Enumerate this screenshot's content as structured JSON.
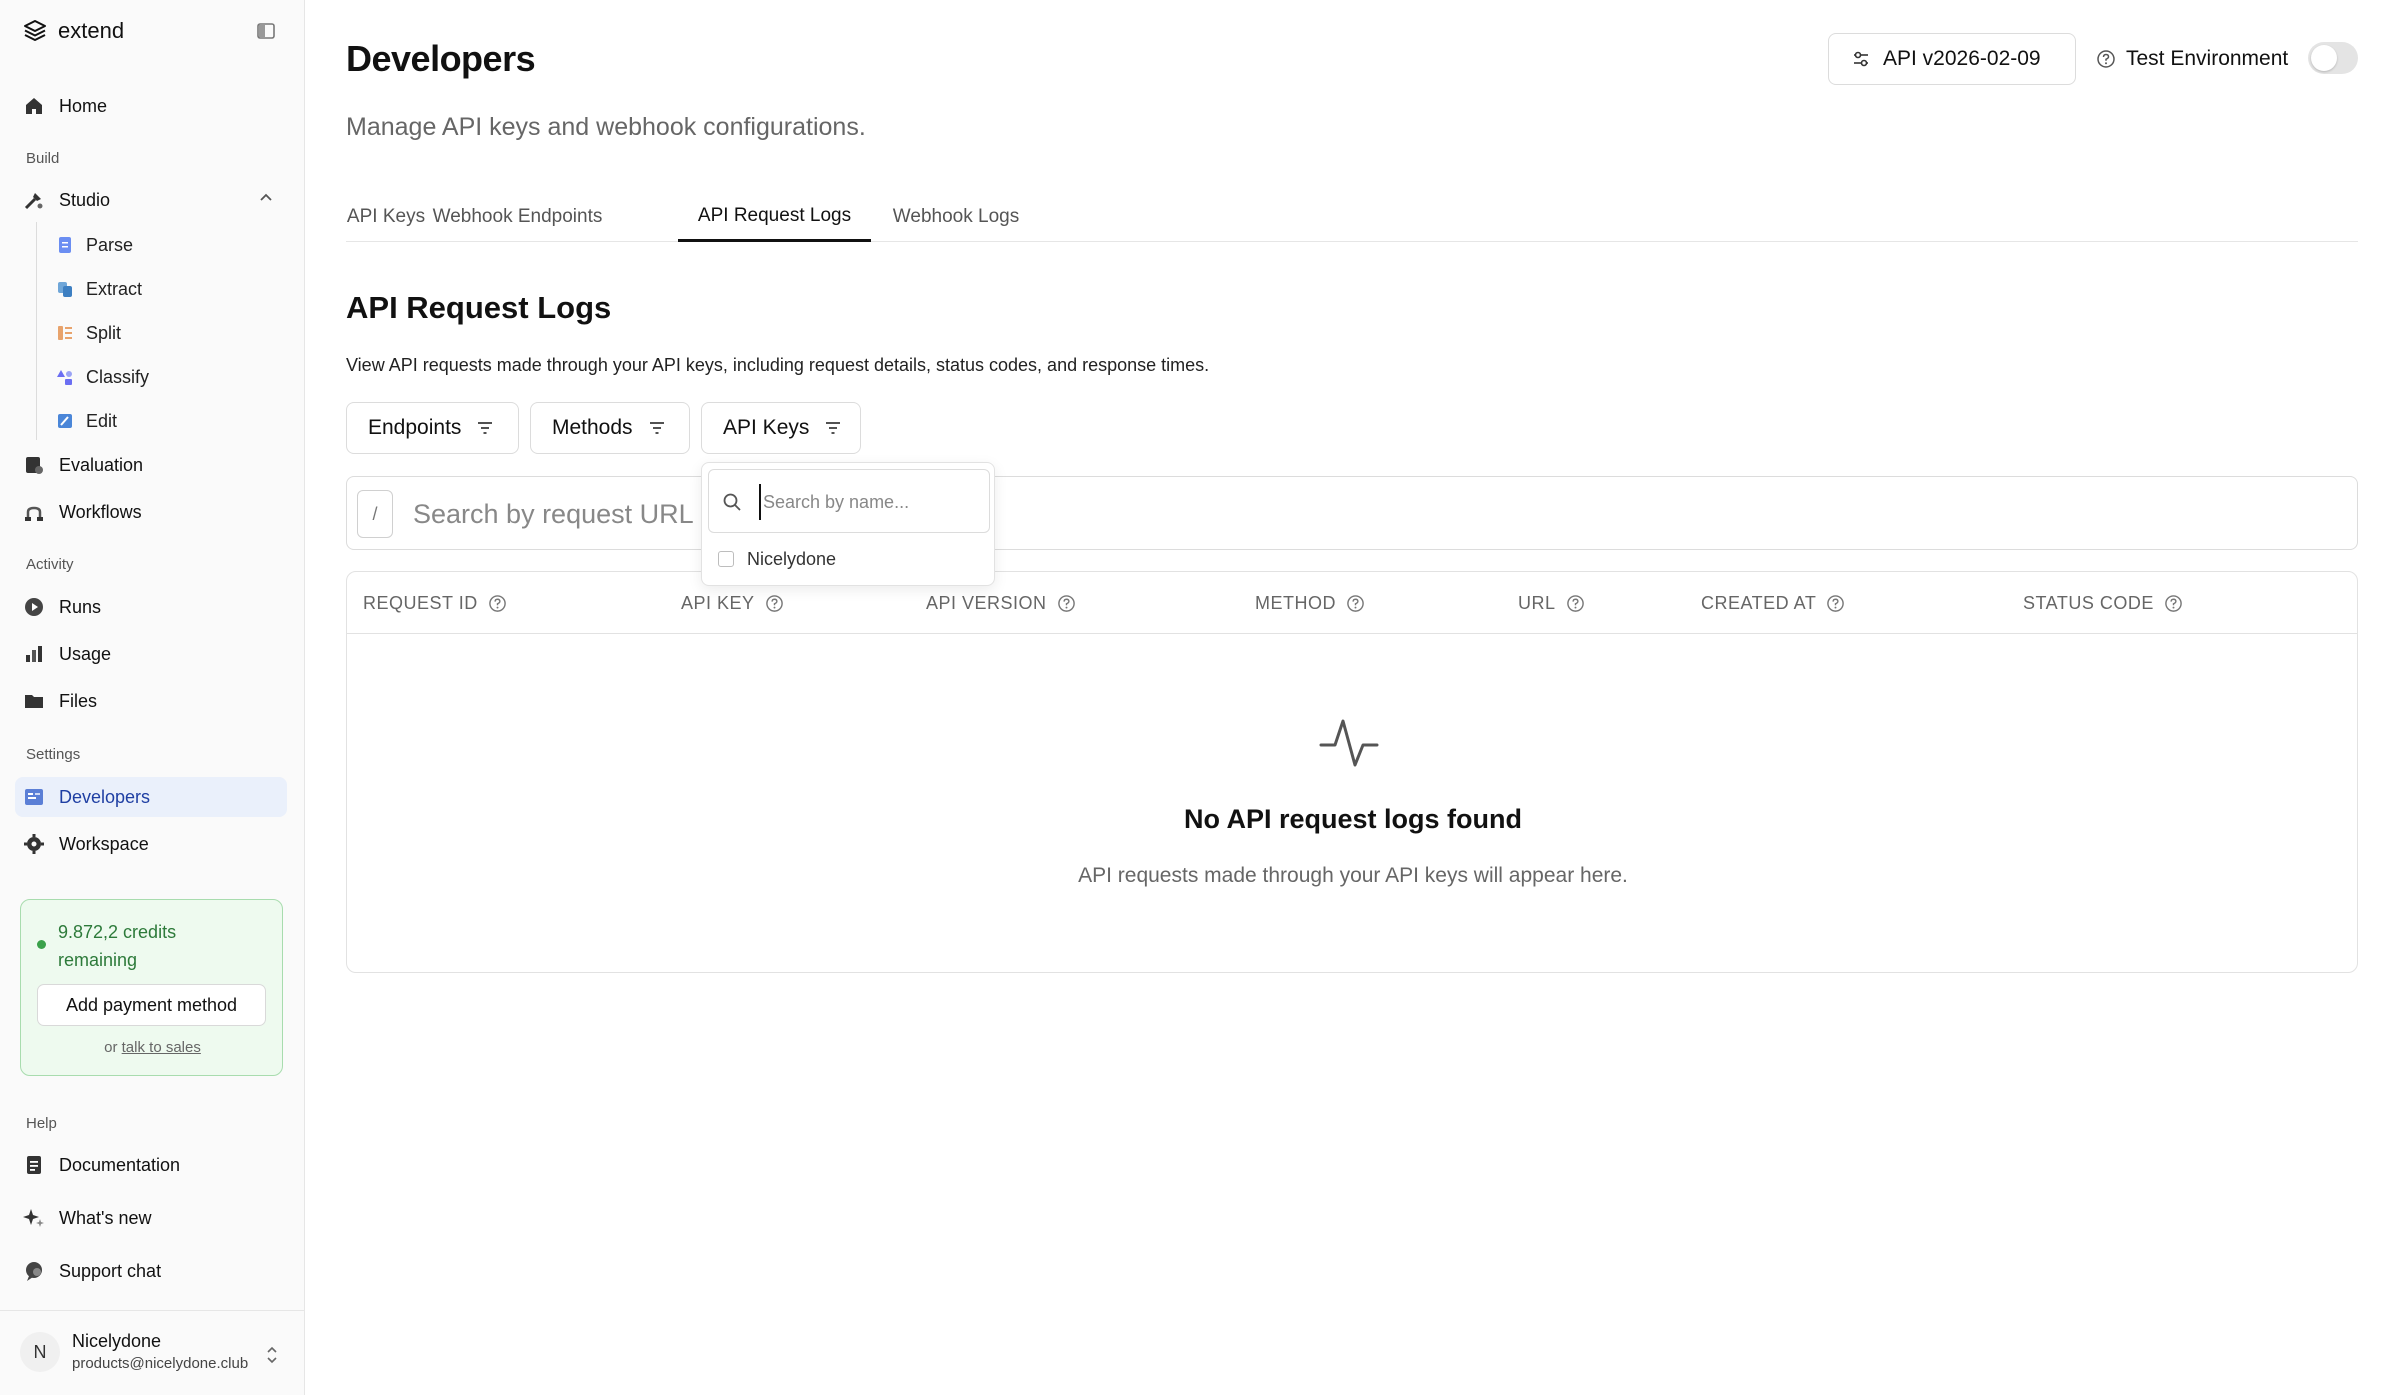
{
  "brand": {
    "name": "extend"
  },
  "sidebar": {
    "home": "Home",
    "sections": {
      "build": "Build",
      "activity": "Activity",
      "settings": "Settings",
      "help": "Help"
    },
    "studio": "Studio",
    "studio_items": [
      "Parse",
      "Extract",
      "Split",
      "Classify",
      "Edit"
    ],
    "evaluation": "Evaluation",
    "workflows": "Workflows",
    "runs": "Runs",
    "usage": "Usage",
    "files": "Files",
    "developers": "Developers",
    "workspace": "Workspace",
    "documentation": "Documentation",
    "whats_new": "What's new",
    "support_chat": "Support chat",
    "credits": {
      "text": "9.872,2 credits remaining",
      "button": "Add payment method",
      "or": "or",
      "sales_link": "talk to sales"
    },
    "user": {
      "initial": "N",
      "name": "Nicelydone",
      "email": "products@nicelydone.club"
    }
  },
  "header": {
    "title": "Developers",
    "subtitle": "Manage API keys and webhook configurations.",
    "api_version": "API v2026-02-09",
    "test_env": "Test Environment"
  },
  "tabs": [
    "API Keys",
    "Webhook Endpoints",
    "API Request Logs",
    "Webhook Logs"
  ],
  "section": {
    "title": "API Request Logs",
    "description": "View API requests made through your API keys, including request details, status codes, and response times."
  },
  "filters": {
    "endpoints": "Endpoints",
    "methods": "Methods",
    "api_keys": "API Keys"
  },
  "search": {
    "shortcut": "/",
    "placeholder": "Search by request URL or ID..."
  },
  "table": {
    "columns": [
      "REQUEST ID",
      "API KEY",
      "API VERSION",
      "METHOD",
      "URL",
      "CREATED AT",
      "STATUS CODE"
    ],
    "empty_title": "No API request logs found",
    "empty_desc": "API requests made through your API keys will appear here."
  },
  "popover": {
    "placeholder": "Search by name...",
    "options": [
      "Nicelydone"
    ]
  },
  "colors": {
    "active_nav_bg": "#eaf0fb",
    "active_nav_text": "#1f3fa3",
    "credits_green": "#2d7a3a"
  }
}
